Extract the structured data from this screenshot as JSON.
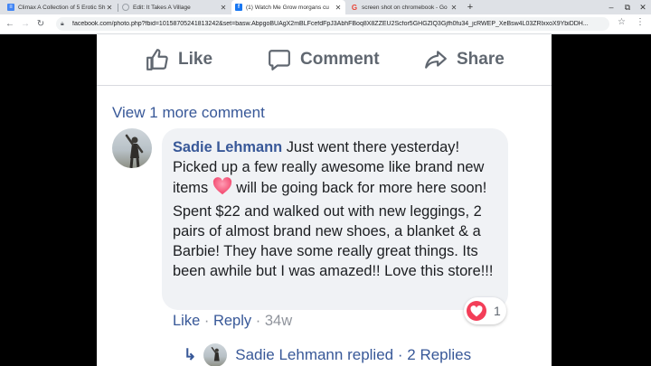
{
  "browser": {
    "tabs": [
      {
        "title": "Climax A Collection of 5 Erotic Sh",
        "icon": "docs-icon",
        "color": "#4285f4"
      },
      {
        "title": "Edit: It Takes A Village",
        "icon": "globe-icon",
        "color": "#9aa0a6"
      },
      {
        "title": "(1) Watch Me Grow morgans cu",
        "icon": "facebook-icon",
        "color": "#1877f2",
        "active": true
      },
      {
        "title": "screen shot on chromebook - Go",
        "icon": "google-icon",
        "color": "#ea4335"
      }
    ],
    "new_tab": "+",
    "url": "facebook.com/photo.php?fbid=10158705241813242&set=basw.AbpgoBUAgX2mBLFcefdFpJ3AbhFBoq8X8ZZEU2Scfor5GHGZlQ3Gjfh0fu34_jcRWEP_XeBsw4L03ZRlxxoX9YbiDDH..."
  },
  "post_actions": {
    "like": "Like",
    "comment": "Comment",
    "share": "Share"
  },
  "comments": {
    "view_more": "View 1 more comment",
    "comment": {
      "author": "Sadie Lehmann",
      "text_part1": "Just went there yesterday! Picked up a few really awesome like brand new items",
      "text_part2": "will be going back for more here soon! Spent $22 and walked out with new leggings, 2 pairs of almost brand new shoes, a blanket & a Barbie! They have some really great things. Its been awhile but I was amazed!! Love this store!!!",
      "reaction_count": "1",
      "like_label": "Like",
      "reply_label": "Reply",
      "separator": "·",
      "time": "34w"
    },
    "replies": {
      "arrow": "↳",
      "author": "Sadie Lehmann",
      "replied_text": "replied",
      "count_text": "2 Replies"
    }
  },
  "colors": {
    "facebook_blue": "#385898",
    "heart_red": "#f33e58",
    "bubble_bg": "#f0f2f5"
  }
}
